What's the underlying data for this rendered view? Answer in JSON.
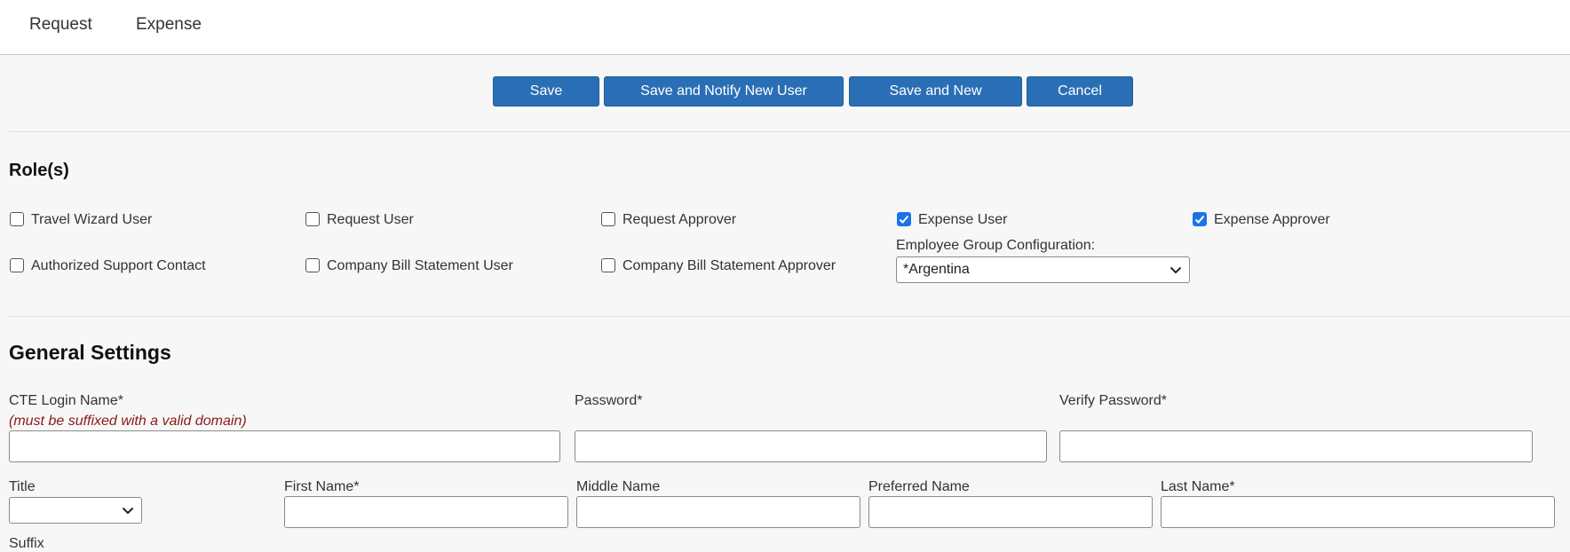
{
  "nav": {
    "tabs": [
      "Request",
      "Expense"
    ]
  },
  "toolbar": {
    "save": "Save",
    "save_notify": "Save and Notify New User",
    "save_new": "Save and New",
    "cancel": "Cancel"
  },
  "roles": {
    "heading": "Role(s)",
    "items": [
      {
        "label": "Travel Wizard User",
        "checked": false
      },
      {
        "label": "Request User",
        "checked": false
      },
      {
        "label": "Request Approver",
        "checked": false
      },
      {
        "label": "Expense User",
        "checked": true
      },
      {
        "label": "Expense Approver",
        "checked": true
      },
      {
        "label": "Authorized Support Contact",
        "checked": false
      },
      {
        "label": "Company Bill Statement User",
        "checked": false
      },
      {
        "label": "Company Bill Statement Approver",
        "checked": false
      }
    ],
    "employee_group_label": "Employee Group Configuration:",
    "employee_group_value": "*Argentina"
  },
  "general": {
    "heading": "General Settings",
    "login_label": "CTE Login Name*",
    "login_hint": "(must be suffixed with a valid domain)",
    "password_label": "Password*",
    "verify_label": "Verify Password*",
    "title_label": "Title",
    "title_value": "",
    "first_label": "First Name*",
    "middle_label": "Middle Name",
    "preferred_label": "Preferred Name",
    "last_label": "Last Name*",
    "suffix_label": "Suffix"
  },
  "colors": {
    "button": "#2a6fb5",
    "checkbox": "#1a73e8",
    "hint": "#8a1a1a"
  }
}
